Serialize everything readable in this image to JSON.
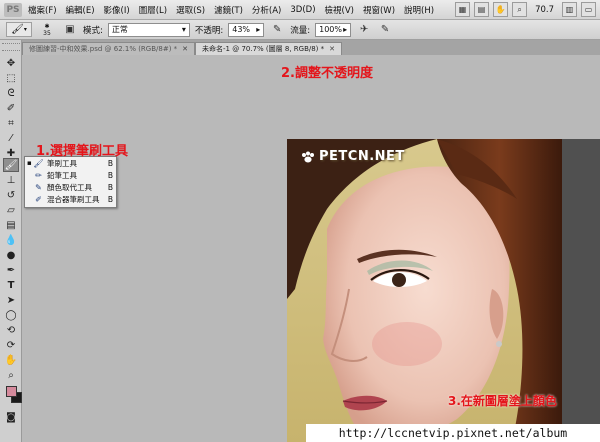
{
  "app": {
    "logo": "PS"
  },
  "menu": {
    "items": [
      "檔案(F)",
      "編輯(E)",
      "影像(I)",
      "圖層(L)",
      "選取(S)",
      "濾鏡(T)",
      "分析(A)",
      "3D(D)",
      "檢視(V)",
      "視窗(W)",
      "說明(H)"
    ],
    "zoom": "70.7"
  },
  "options": {
    "brush_size": "35",
    "mode_label": "模式:",
    "mode_value": "正常",
    "opacity_label": "不透明:",
    "opacity_value": "43%",
    "flow_label": "流量:",
    "flow_value": "100%"
  },
  "tabs": [
    {
      "label": "修圖練習-中和效果.psd @ 62.1% (RGB/8#) *",
      "active": false
    },
    {
      "label": "未命名-1 @ 70.7% (圖層 8, RGB/8) *",
      "active": true
    }
  ],
  "flyout": {
    "items": [
      {
        "label": "筆刷工具",
        "key": "B",
        "icon": "brush-icon",
        "current": true
      },
      {
        "label": "鉛筆工具",
        "key": "B",
        "icon": "pencil-icon",
        "current": false
      },
      {
        "label": "顏色取代工具",
        "key": "B",
        "icon": "color-replacement-icon",
        "current": false
      },
      {
        "label": "混合器筆刷工具",
        "key": "B",
        "icon": "mixer-brush-icon",
        "current": false
      }
    ]
  },
  "annotations": {
    "step1": "1.選擇筆刷工具",
    "step2": "2.調整不透明度",
    "step3": "3.在新圖層塗上顏色"
  },
  "photo": {
    "watermark": "PETCN.NET"
  },
  "footer": {
    "url": "http://lccnetvip.pixnet.net/album"
  },
  "colors": {
    "annotation": "#e4151b",
    "foreground_swatch": "#d58a9c",
    "background_swatch": "#1a1a1a"
  }
}
